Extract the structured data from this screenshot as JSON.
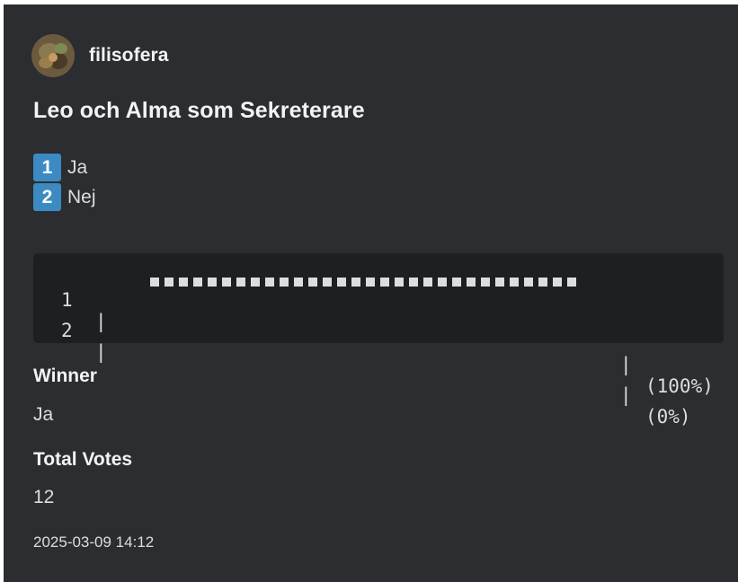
{
  "author": {
    "name": "filisofera",
    "avatar_icon": "user-avatar-photo"
  },
  "poll": {
    "title": "Leo och Alma som Sekreterare",
    "options": [
      {
        "number": "1",
        "label": "Ja"
      },
      {
        "number": "2",
        "label": "Nej"
      }
    ],
    "results": [
      {
        "number": "1",
        "separator": "|",
        "pipe": "|",
        "percent": "(100%)",
        "share": 1.0
      },
      {
        "number": "2",
        "separator": "|",
        "pipe": "|",
        "percent": "(0%)",
        "share": 0.0
      }
    ]
  },
  "fields": {
    "winner_label": "Winner",
    "winner_value": "Ja",
    "total_label": "Total Votes",
    "total_value": "12"
  },
  "timestamp": "2025-03-09 14:12",
  "colors": {
    "embed_bg": "#2b2d31",
    "code_bg": "#1e1f22",
    "badge": "#3c8ac2",
    "text": "#dbdee1",
    "heading": "#f2f3f5"
  }
}
